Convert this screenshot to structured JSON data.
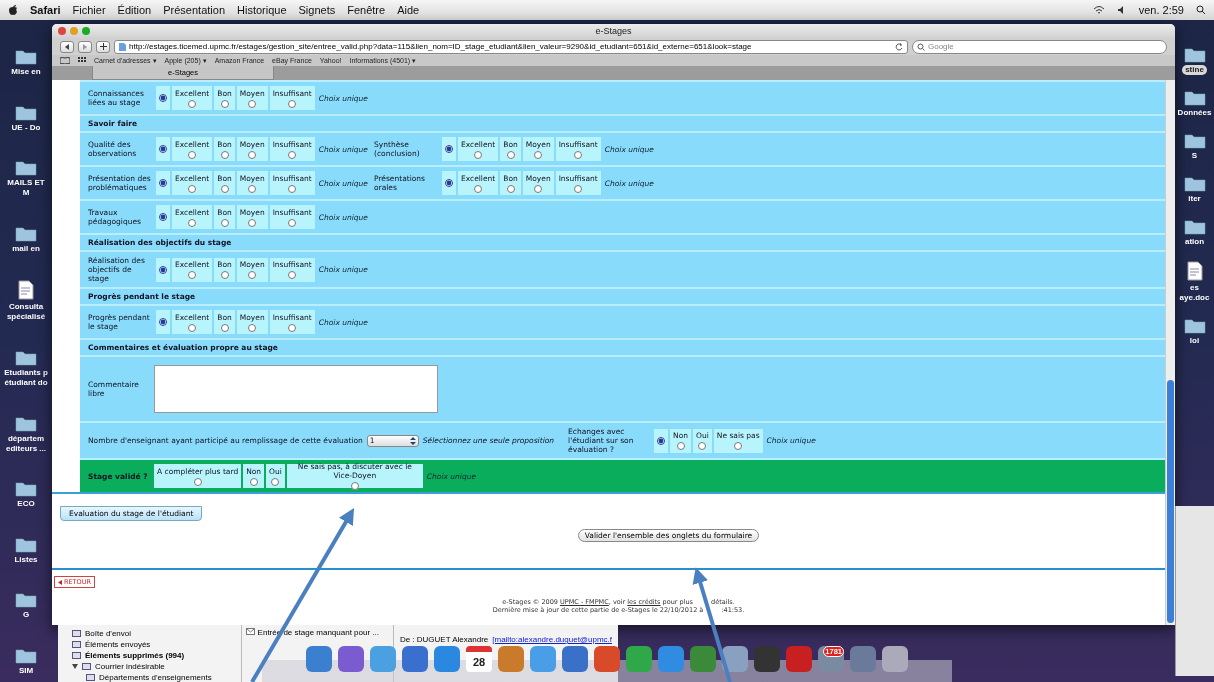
{
  "menubar": {
    "app": "Safari",
    "menus": [
      "Fichier",
      "Édition",
      "Présentation",
      "Historique",
      "Signets",
      "Fenêtre",
      "Aide"
    ],
    "clock": "ven. 2:59"
  },
  "desktop_left": [
    {
      "label": "Mise en",
      "kind": "folder",
      "selected": false
    },
    {
      "label": "UE - Do",
      "kind": "folder",
      "selected": false
    },
    {
      "label": "MAILS ET M",
      "kind": "folder",
      "selected": false
    },
    {
      "label": "mail en",
      "kind": "folder",
      "selected": false
    },
    {
      "label": "Consulta\nspécialisé",
      "kind": "document",
      "selected": false
    },
    {
      "label": "Etudiants p\nétudiant do",
      "kind": "folder",
      "selected": false
    },
    {
      "label": "départem\nediteurs ...",
      "kind": "folder",
      "selected": false
    },
    {
      "label": "ECO",
      "kind": "folder",
      "selected": false
    },
    {
      "label": "Listes",
      "kind": "folder",
      "selected": false
    },
    {
      "label": "G",
      "kind": "folder",
      "selected": false
    },
    {
      "label": "SIM",
      "kind": "folder",
      "selected": false
    }
  ],
  "desktop_right": [
    {
      "label": "stine",
      "kind": "folder",
      "selected": true
    },
    {
      "label": "Données",
      "kind": "folder",
      "selected": false
    },
    {
      "label": "S",
      "kind": "folder",
      "selected": false
    },
    {
      "label": "iter",
      "kind": "folder",
      "selected": false
    },
    {
      "label": "ation",
      "kind": "folder",
      "selected": false
    },
    {
      "label": "es\naye.doc",
      "kind": "document",
      "selected": false
    },
    {
      "label": "loi",
      "kind": "folder",
      "selected": false
    }
  ],
  "browser": {
    "title": "e-Stages",
    "url": "http://estages.ticemed.upmc.fr/estages/gestion_site/entree_valid.php?data=115&lien_nom=ID_stage_etudiant&lien_valeur=9290&id_etudiant=651&id_externe=651&look=stage",
    "search_placeholder": "Google",
    "bookmarks": [
      "Carnet d'adresses ▾",
      "Apple (205) ▾",
      "Amazon France",
      "eBay France",
      "Yahoo!",
      "Informations (4501) ▾"
    ],
    "tabs": [
      {
        "label": "e-Stages",
        "selected": true
      }
    ]
  },
  "form": {
    "sections": [
      {
        "rows": [
          {
            "kind": "questions",
            "questions": [
              {
                "label": "Connaissances liées au stage",
                "blank_selected": true,
                "options": [
                  {
                    "label": "Excellent",
                    "selected": false
                  },
                  {
                    "label": "Bon",
                    "selected": false
                  },
                  {
                    "label": "Moyen",
                    "selected": false
                  },
                  {
                    "label": "Insuffisant",
                    "selected": false
                  }
                ],
                "note": "Choix unique"
              }
            ]
          }
        ]
      },
      {
        "heading": "Savoir faire",
        "rows": [
          {
            "kind": "questions",
            "questions": [
              {
                "label": "Qualité des observations",
                "blank_selected": true,
                "options": [
                  {
                    "label": "Excellent",
                    "selected": false
                  },
                  {
                    "label": "Bon",
                    "selected": false
                  },
                  {
                    "label": "Moyen",
                    "selected": false
                  },
                  {
                    "label": "Insuffisant",
                    "selected": false
                  }
                ],
                "note": "Choix unique"
              },
              {
                "label": "Synthèse (conclusion)",
                "blank_selected": true,
                "options": [
                  {
                    "label": "Excellent",
                    "selected": false
                  },
                  {
                    "label": "Bon",
                    "selected": false
                  },
                  {
                    "label": "Moyen",
                    "selected": false
                  },
                  {
                    "label": "Insuffisant",
                    "selected": false
                  }
                ],
                "note": "Choix unique"
              }
            ]
          },
          {
            "kind": "questions",
            "questions": [
              {
                "label": "Présentation des problématiques",
                "blank_selected": true,
                "options": [
                  {
                    "label": "Excellent",
                    "selected": false
                  },
                  {
                    "label": "Bon",
                    "selected": false
                  },
                  {
                    "label": "Moyen",
                    "selected": false
                  },
                  {
                    "label": "Insuffisant",
                    "selected": false
                  }
                ],
                "note": "Choix unique"
              },
              {
                "label": "Présentations orales",
                "blank_selected": true,
                "options": [
                  {
                    "label": "Excellent",
                    "selected": false
                  },
                  {
                    "label": "Bon",
                    "selected": false
                  },
                  {
                    "label": "Moyen",
                    "selected": false
                  },
                  {
                    "label": "Insuffisant",
                    "selected": false
                  }
                ],
                "note": "Choix unique"
              }
            ]
          },
          {
            "kind": "questions",
            "questions": [
              {
                "label": "Travaux pédagogiques",
                "blank_selected": true,
                "options": [
                  {
                    "label": "Excellent",
                    "selected": false
                  },
                  {
                    "label": "Bon",
                    "selected": false
                  },
                  {
                    "label": "Moyen",
                    "selected": false
                  },
                  {
                    "label": "Insuffisant",
                    "selected": false
                  }
                ],
                "note": "Choix unique"
              }
            ]
          }
        ]
      },
      {
        "heading": "Réalisation des objectifs du stage",
        "rows": [
          {
            "kind": "questions",
            "questions": [
              {
                "label": "Réalisation des objectifs de stage",
                "blank_selected": true,
                "options": [
                  {
                    "label": "Excellent",
                    "selected": false
                  },
                  {
                    "label": "Bon",
                    "selected": false
                  },
                  {
                    "label": "Moyen",
                    "selected": false
                  },
                  {
                    "label": "Insuffisant",
                    "selected": false
                  }
                ],
                "note": "Choix unique"
              }
            ]
          }
        ]
      },
      {
        "heading": "Progrès pendant le stage",
        "rows": [
          {
            "kind": "questions",
            "questions": [
              {
                "label": "Progrès pendant le stage",
                "blank_selected": true,
                "options": [
                  {
                    "label": "Excellent",
                    "selected": false
                  },
                  {
                    "label": "Bon",
                    "selected": false
                  },
                  {
                    "label": "Moyen",
                    "selected": false
                  },
                  {
                    "label": "Insuffisant",
                    "selected": false
                  }
                ],
                "note": "Choix unique"
              }
            ]
          }
        ]
      },
      {
        "heading": "Commentaires et évaluation propre au stage",
        "rows": [
          {
            "kind": "comment",
            "label": "Commentaire libre"
          },
          {
            "kind": "count",
            "label": "Nombre d'enseignant ayant participé au remplissage de cette évaluation",
            "select_value": "1",
            "hint": "Sélectionnez une seule proposition",
            "question": {
              "label": "Echanges avec l'étudiant sur son évaluation ?",
              "blank_selected": true,
              "options": [
                {
                  "label": "Non",
                  "selected": false
                },
                {
                  "label": "Oui",
                  "selected": false
                },
                {
                  "label": "Ne sais pas",
                  "selected": false
                }
              ],
              "note": "Choix unique"
            }
          }
        ]
      }
    ],
    "validation": {
      "label": "Stage validé ?",
      "options": [
        {
          "label": "A compléter plus tard",
          "selected": false
        },
        {
          "label": "Non",
          "selected": false
        },
        {
          "label": "Oui",
          "selected": false
        },
        {
          "label": "Ne sais pas, à discuter avec le Vice-Doyen",
          "selected": false
        }
      ],
      "note": "Choix unique"
    }
  },
  "page_tab": "Evaluation du stage de l'étudiant",
  "submit": "Valider l'ensemble des onglets du formulaire",
  "back_link": "RETOUR",
  "footer": {
    "before": "e-Stages © 2009",
    "upmc_link": "UPMC - FMPMC",
    "middle": ", voir",
    "credits_link": "les crédits",
    "after": "pour plus",
    "after_arrow": "détails.",
    "update": "Dernière mise à jour de cette partie de e-Stages le 22/10/2012 à",
    "update_after_arrow": ":41:53."
  },
  "mail": {
    "folders": [
      {
        "label": "Boîte d'envoi",
        "unread": false
      },
      {
        "label": "Éléments envoyés",
        "unread": false
      },
      {
        "label": "Éléments supprimés (994)",
        "unread": true
      },
      {
        "label": "Courrier indésirable",
        "unread": false,
        "expanded": true,
        "children": [
          {
            "label": "Départements d'enseignements",
            "unread": false
          }
        ]
      }
    ],
    "message_subject": "Entrée de stage manquant pour ...",
    "sender": "De : DUGUET Alexandre",
    "sender_link": "[mailto:alexandre.duguet@upmc.f"
  },
  "dock": {
    "calendar_day": "28",
    "mail_badge": "1781"
  }
}
